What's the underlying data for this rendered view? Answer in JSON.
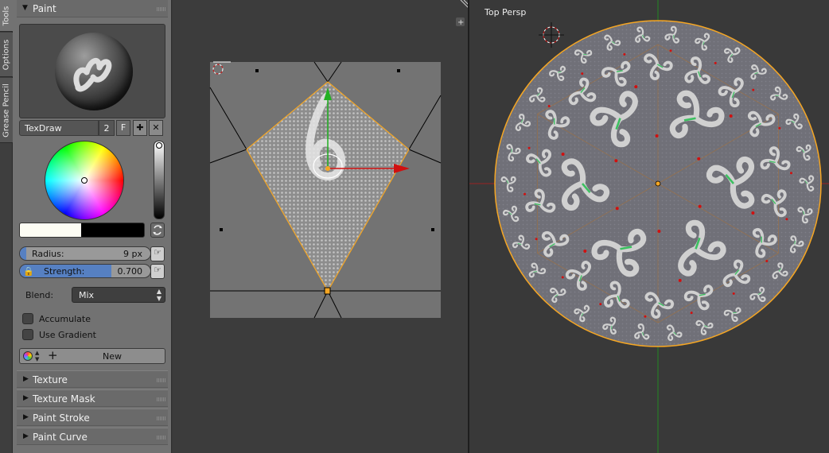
{
  "tabs": {
    "tools": "Tools",
    "options": "Options",
    "grease_pencil": "Grease Pencil"
  },
  "paint_panel": {
    "title": "Paint",
    "brush_name": "TexDraw",
    "user_count": "2",
    "fake_user": "F",
    "radius_label": "Radius:",
    "radius_value": "9 px",
    "strength_label": "Strength:",
    "strength_value": "0.700",
    "strength_fraction": 0.7,
    "blend_label": "Blend:",
    "blend_value": "Mix",
    "accumulate_label": "Accumulate",
    "use_gradient_label": "Use Gradient",
    "new_label": "New",
    "primary_color": "#fdfdf4",
    "secondary_color": "#000000"
  },
  "subpanels": [
    "Texture",
    "Texture Mask",
    "Paint Stroke",
    "Paint Curve"
  ],
  "viewport": {
    "label": "Top Persp"
  },
  "colors": {
    "accent": "#5680c2",
    "selection": "#f5a623",
    "x_axis": "#d01010",
    "y_axis": "#22b022"
  }
}
